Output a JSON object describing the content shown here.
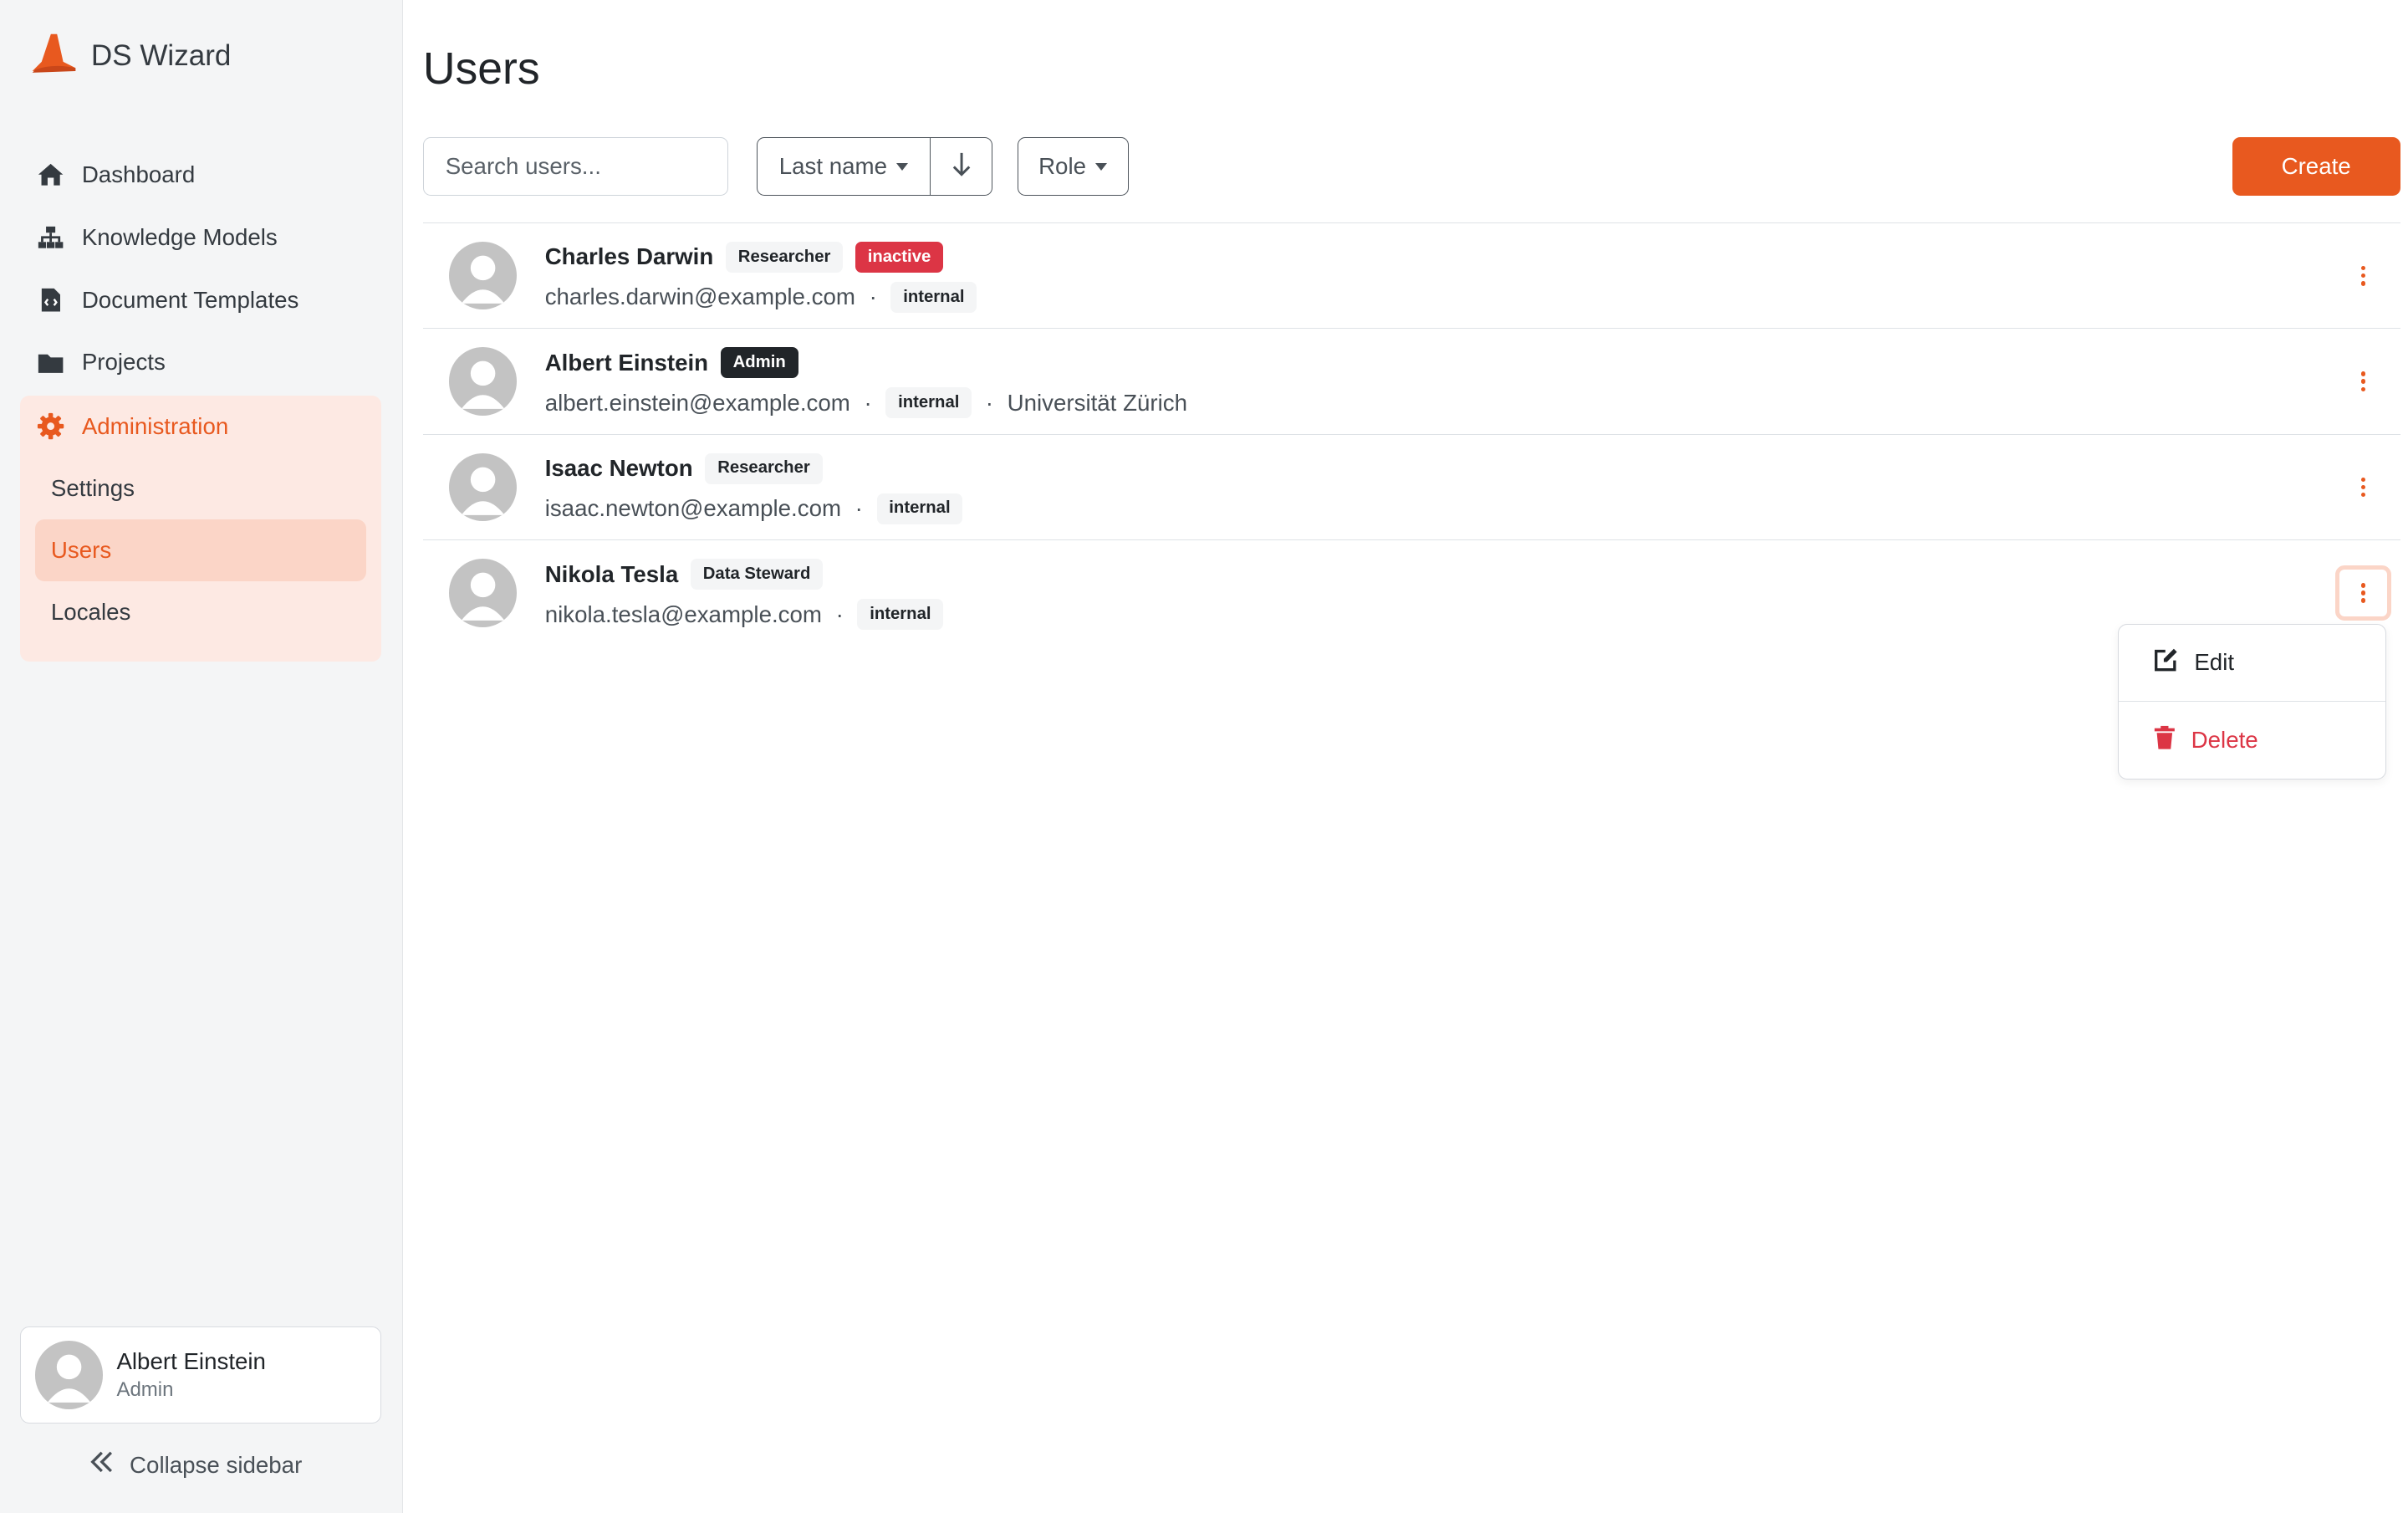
{
  "brand": {
    "name": "DS Wizard",
    "color": "#e8591f"
  },
  "nav": {
    "dashboard": "Dashboard",
    "knowledge_models": "Knowledge Models",
    "document_templates": "Document Templates",
    "projects": "Projects",
    "administration": "Administration",
    "settings": "Settings",
    "users": "Users",
    "locales": "Locales"
  },
  "profile": {
    "name": "Albert Einstein",
    "role": "Admin"
  },
  "collapse_label": "Collapse sidebar",
  "page": {
    "title": "Users"
  },
  "toolbar": {
    "search_placeholder": "Search users...",
    "sort_field": "Last name",
    "role_filter": "Role",
    "create_label": "Create"
  },
  "users": [
    {
      "name": "Charles Darwin",
      "role": "Researcher",
      "status": "inactive",
      "email": "charles.darwin@example.com",
      "source": "internal",
      "affiliation": ""
    },
    {
      "name": "Albert Einstein",
      "role": "Admin",
      "status": "",
      "email": "albert.einstein@example.com",
      "source": "internal",
      "affiliation": "Universität Zürich"
    },
    {
      "name": "Isaac Newton",
      "role": "Researcher",
      "status": "",
      "email": "isaac.newton@example.com",
      "source": "internal",
      "affiliation": ""
    },
    {
      "name": "Nikola Tesla",
      "role": "Data Steward",
      "status": "",
      "email": "nikola.tesla@example.com",
      "source": "internal",
      "affiliation": ""
    }
  ],
  "dropdown": {
    "edit": "Edit",
    "delete": "Delete"
  },
  "icons": {
    "dashboard": "home-icon",
    "knowledge_models": "sitemap-icon",
    "document_templates": "file-code-icon",
    "projects": "folder-icon",
    "administration": "gear-icon",
    "collapse": "double-chevron-left-icon",
    "sort_direction": "arrow-down-icon",
    "row_menu": "kebab-icon",
    "edit": "edit-icon",
    "delete": "trash-icon"
  }
}
